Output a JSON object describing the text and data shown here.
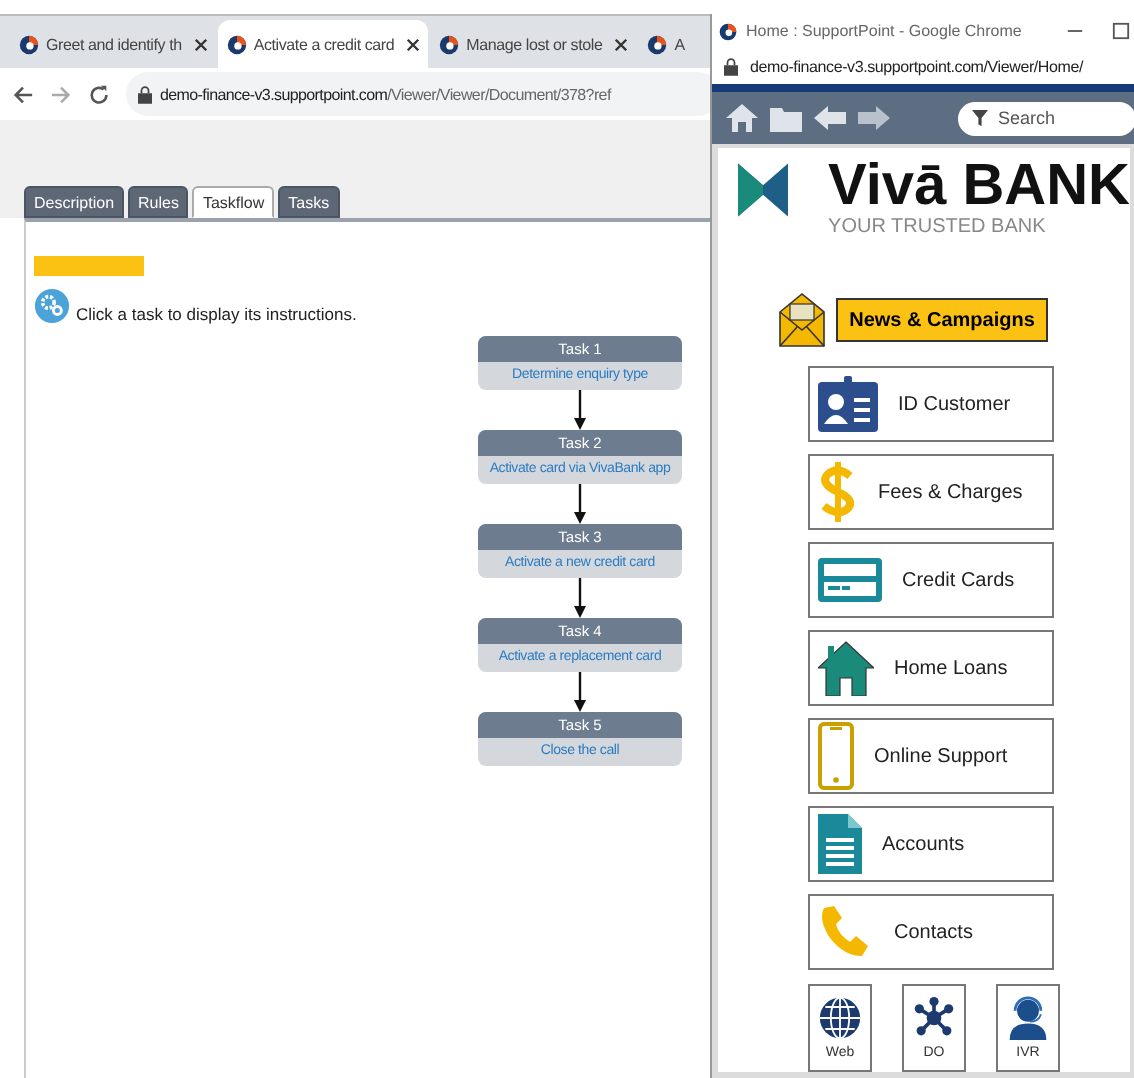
{
  "browser": {
    "tabs": [
      {
        "title": "Greet and identify th",
        "selected": false
      },
      {
        "title": "Activate a credit card",
        "selected": true
      },
      {
        "title": "Manage lost or stole",
        "selected": false
      },
      {
        "title": "A",
        "selected": false
      }
    ],
    "url_host": "demo-finance-v3.supportpoint.com",
    "url_path": "/Viewer/Viewer/Document/378?ref"
  },
  "viewer": {
    "tabs": [
      {
        "label": "Description",
        "selected": false
      },
      {
        "label": "Rules",
        "selected": false
      },
      {
        "label": "Taskflow",
        "selected": true
      },
      {
        "label": "Tasks",
        "selected": false
      }
    ],
    "hint": "Click a task to display its instructions.",
    "tasks": [
      {
        "label": "Task 1",
        "name": "Determine enquiry type"
      },
      {
        "label": "Task 2",
        "name": "Activate card via VivaBank app"
      },
      {
        "label": "Task 3",
        "name": "Activate a new credit card"
      },
      {
        "label": "Task 4",
        "name": "Activate a replacement card"
      },
      {
        "label": "Task 5",
        "name": "Close the call"
      }
    ]
  },
  "popup": {
    "title": "Home : SupportPoint - Google Chrome",
    "url_host": "demo-finance-v3.supportpoint.com",
    "url_path": "/Viewer/Home/",
    "search": {
      "placeholder": "Search"
    },
    "brand": {
      "name": "Vivā BANK",
      "tagline": "YOUR TRUSTED BANK"
    },
    "news": "News & Campaigns",
    "menu": [
      {
        "label": "ID Customer"
      },
      {
        "label": "Fees & Charges"
      },
      {
        "label": "Credit Cards"
      },
      {
        "label": "Home Loans"
      },
      {
        "label": "Online Support"
      },
      {
        "label": "Accounts"
      },
      {
        "label": "Contacts"
      }
    ],
    "shortcuts": [
      {
        "label": "Web"
      },
      {
        "label": "DO"
      },
      {
        "label": "IVR"
      }
    ]
  }
}
